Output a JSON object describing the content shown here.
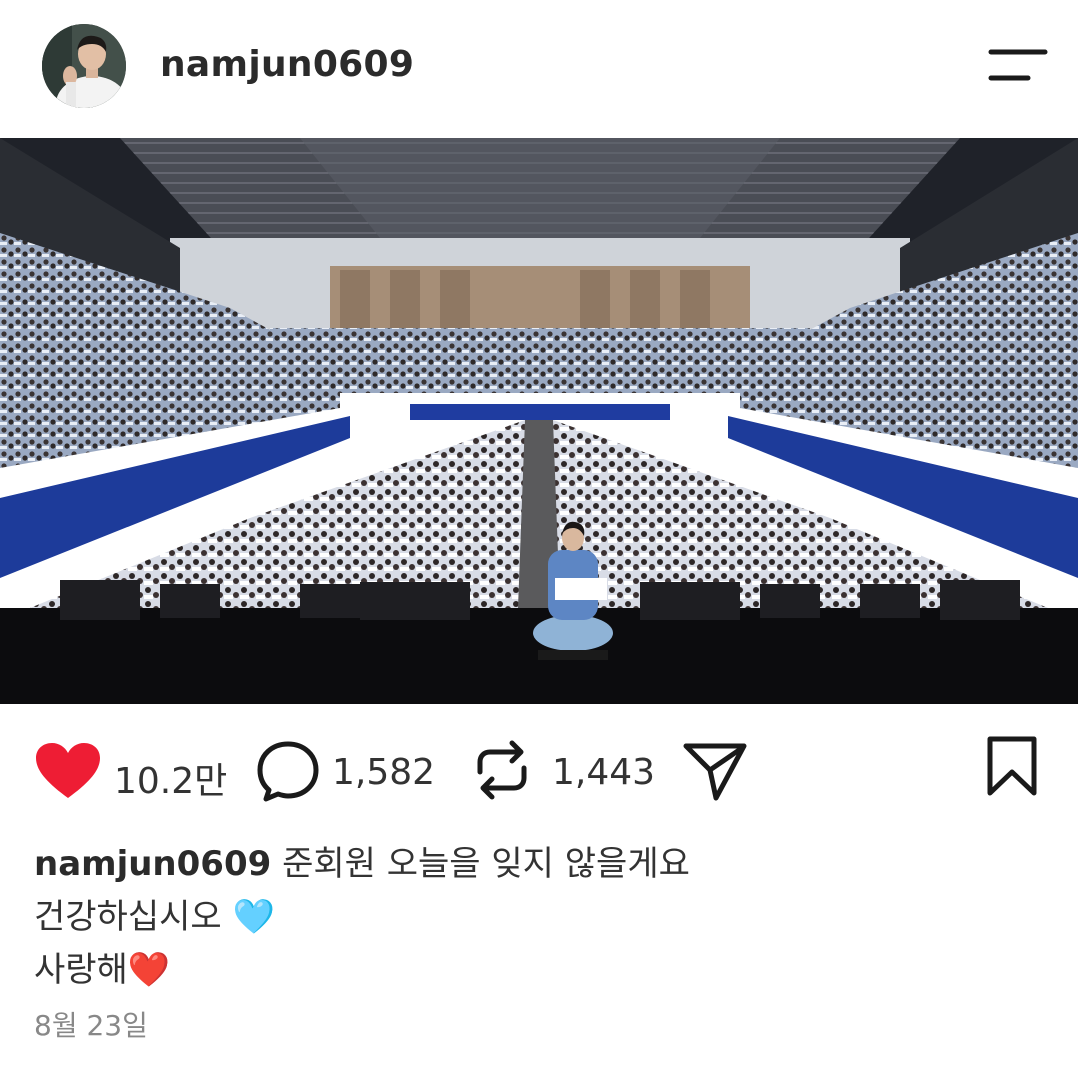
{
  "post": {
    "username": "namjun0609",
    "photo_alt": "Concert hall with audience holding banners",
    "likes": "10.2만",
    "comments": "1,582",
    "reposts": "1,443",
    "caption_line1": "준회원 오늘을 잊지 않을게요",
    "caption_line2": "건강하십시오",
    "caption_line2_emoji": "🩵",
    "caption_line3": "사랑해",
    "caption_line3_emoji": "❤️",
    "date": "8월 23일"
  },
  "colors": {
    "heart": "#ee1d34",
    "icon": "#1a1a1a",
    "muted": "#888888"
  },
  "icons": {
    "menu": "menu-icon",
    "like": "heart-icon",
    "comment": "comment-icon",
    "repost": "repost-icon",
    "share": "send-icon",
    "save": "bookmark-icon"
  }
}
